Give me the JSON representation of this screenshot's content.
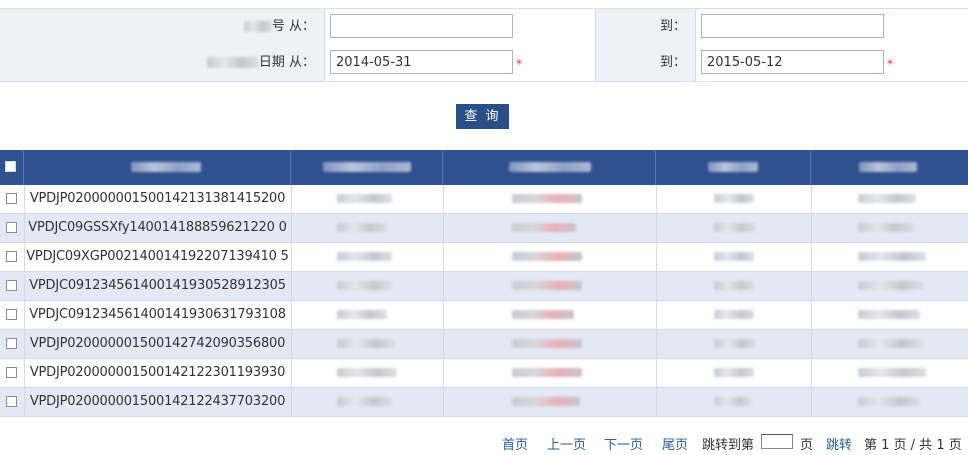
{
  "form": {
    "row1": {
      "label_suffix": "号 从：",
      "to_label": "到：",
      "from_value": "",
      "to_value": ""
    },
    "row2": {
      "label_suffix": "日期 从：",
      "to_label": "到：",
      "from_value": "2014-05-31",
      "to_value": "2015-05-12",
      "required_mark": "*"
    },
    "query_button": "查 询"
  },
  "table": {
    "rows": [
      {
        "id": "VPDJP020000001500142131381415200"
      },
      {
        "id": "VPDJC09GSSXfy140014188859621220 0"
      },
      {
        "id": "VPDJC09XGP002140014192207139410 5"
      },
      {
        "id": "VPDJC091234561400141930528912305"
      },
      {
        "id": "VPDJC091234561400141930631793108"
      },
      {
        "id": "VPDJP020000001500142742090356800"
      },
      {
        "id": "VPDJP020000001500142122301193930"
      },
      {
        "id": "VPDJP020000001500142122437703200"
      }
    ]
  },
  "pager": {
    "first": "首页",
    "prev": "上一页",
    "next": "下一页",
    "last": "尾页",
    "jump_prefix": "跳转到第",
    "page_unit": "页",
    "jump_button": "跳转",
    "status": "第 1 页 / 共 1 页",
    "jump_value": ""
  },
  "colors": {
    "header_bg": "#2f5190",
    "button_bg": "#2a4f86",
    "row_alt": "#e2e9f5",
    "link": "#2a5c9e",
    "required": "#e03030"
  }
}
